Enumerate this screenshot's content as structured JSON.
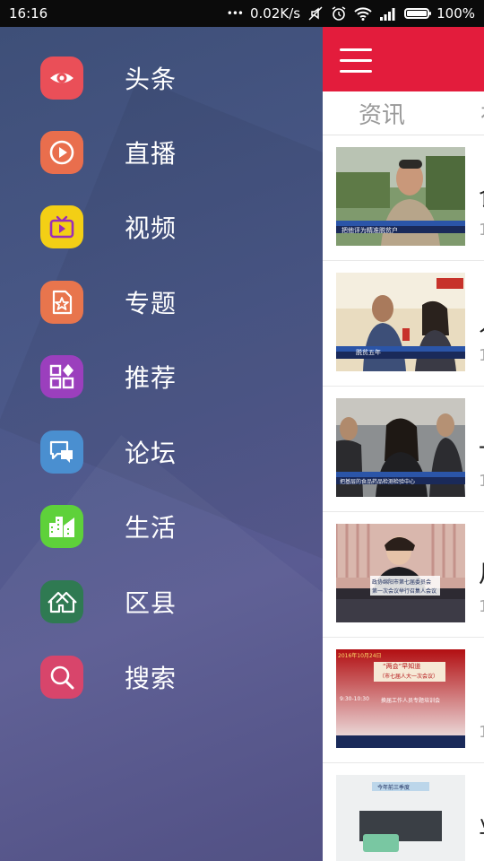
{
  "status": {
    "time": "16:16",
    "dots": "•••",
    "net_speed": "0.02K/s",
    "battery": "100%",
    "battery_level": 1.0
  },
  "menu": [
    {
      "label": "头条",
      "icon": "eye-icon",
      "color": "#ea4f58"
    },
    {
      "label": "直播",
      "icon": "play-circle-icon",
      "color": "#e96e4d"
    },
    {
      "label": "视频",
      "icon": "tv-icon",
      "color": "#f3cf15"
    },
    {
      "label": "专题",
      "icon": "star-document-icon",
      "color": "#e8754d"
    },
    {
      "label": "推荐",
      "icon": "grid-diamond-icon",
      "color": "#9b3fbd"
    },
    {
      "label": "论坛",
      "icon": "chat-bubbles-icon",
      "color": "#4a8fd0"
    },
    {
      "label": "生活",
      "icon": "city-buildings-icon",
      "color": "#5ed13a"
    },
    {
      "label": "区县",
      "icon": "houses-icon",
      "color": "#2f7a52"
    },
    {
      "label": "搜索",
      "icon": "search-icon",
      "color": "#d8456b"
    }
  ],
  "content": {
    "accent": "#e31c3c",
    "tabs": [
      "资讯",
      "视"
    ],
    "news": [
      {
        "title_peek": "食",
        "date_peek": "1",
        "thumb_caption": "把他评为精准脱贫户"
      },
      {
        "title_peek": "人",
        "date_peek": "1",
        "thumb_caption": "脱贫五年"
      },
      {
        "title_peek": "一",
        "date_peek": "1",
        "thumb_caption": "把基层的食品药品检测检验中心"
      },
      {
        "title_peek": "片",
        "date_peek": "1",
        "thumb_caption_1": "政协绵阳市第七届委员会",
        "thumb_caption_2": "第一次会议举行召集人会议"
      },
      {
        "title_peek": "",
        "date_peek": "1",
        "thumb_date": "2016年10月24日",
        "thumb_headline": "“两会”早知道",
        "thumb_sub": "（市七届人大一次会议）",
        "thumb_time": "9:30-10:30",
        "thumb_text": "换届工作人员专题培训会"
      },
      {
        "title_peek": "业",
        "date_peek": "",
        "thumb_caption": "今年前三季度"
      }
    ]
  }
}
